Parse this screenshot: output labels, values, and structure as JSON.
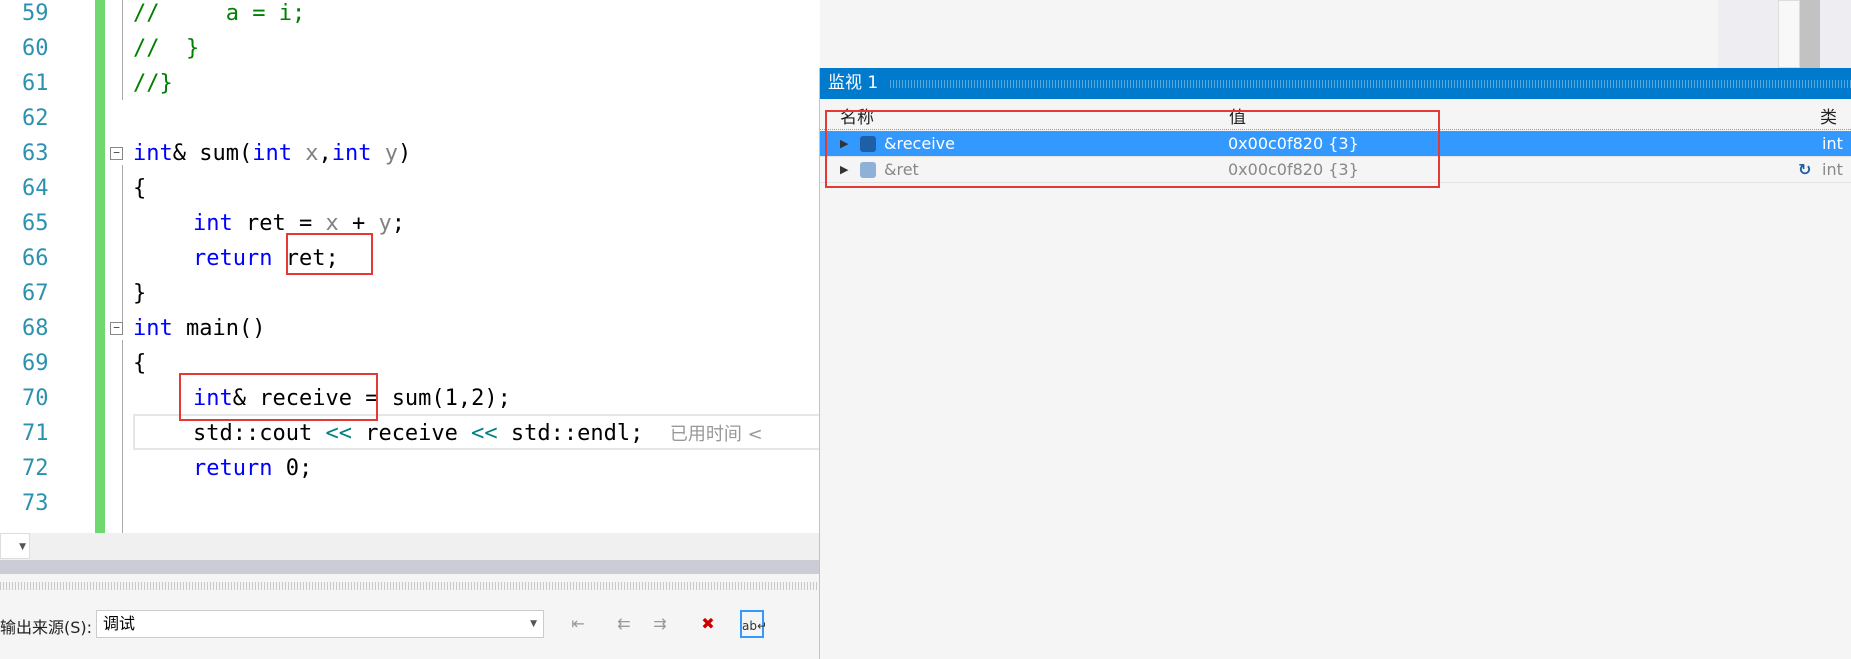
{
  "editor": {
    "lines": [
      {
        "n": "59"
      },
      {
        "n": "60"
      },
      {
        "n": "61"
      },
      {
        "n": "62"
      },
      {
        "n": "63"
      },
      {
        "n": "64"
      },
      {
        "n": "65"
      },
      {
        "n": "66"
      },
      {
        "n": "67"
      },
      {
        "n": "68"
      },
      {
        "n": "69"
      },
      {
        "n": "70"
      },
      {
        "n": "71"
      },
      {
        "n": "72"
      },
      {
        "n": "73"
      }
    ],
    "code": {
      "l59a": "//",
      "l59b": "a = i;",
      "l60": "//  }",
      "l61": "//}",
      "l63kw": "int",
      "l63a": "& sum(",
      "l63kw2": "int",
      "l63x": " x",
      ",": ",",
      "l63kw3": "int",
      "l63y": " y",
      ")": ")",
      "l64": "{",
      "l65kw": "int",
      "l65a": " ret = ",
      "l65x": "x",
      "l65p": " + ",
      "l65y": "y",
      "l65s": ";",
      "l66kw": "return",
      "l66a": " ret;",
      "l67": "}",
      "l68kw": "int",
      "l68a": " main()",
      "l69": "{",
      "l70kw": "int",
      "l70a": "& receive = sum(1,2);",
      "l71a": "std::cout ",
      "l71op": "<<",
      "l71b": " receive ",
      "l71op2": "<<",
      "l71c": " std::endl;",
      "l71hint": "已用时间 <",
      "l72kw": "return",
      "l72a": " 0;"
    }
  },
  "output": {
    "source_label": "输出来源(S):",
    "source_value": "调试"
  },
  "watch": {
    "title": "监视 1",
    "columns": {
      "name": "名称",
      "value": "值",
      "type": "类型"
    },
    "rows": [
      {
        "name": "&receive",
        "value": "0x00c0f820 {3}",
        "type": "int",
        "selected": true
      },
      {
        "name": "&ret",
        "value": "0x00c0f820 {3}",
        "type": "int",
        "selected": false
      }
    ]
  },
  "colors": {
    "accent": "#007acc",
    "selection": "#3399ff",
    "highlight_box": "#e53935"
  }
}
